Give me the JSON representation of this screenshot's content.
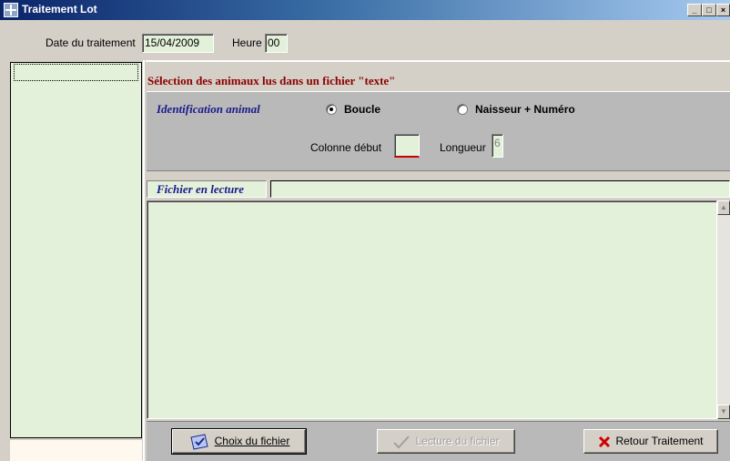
{
  "window": {
    "title": "Traitement Lot"
  },
  "header": {
    "date_label": "Date du traitement",
    "date_value": "15/04/2009",
    "heure_label": "Heure",
    "heure_value": "00"
  },
  "main": {
    "selection_title": "Sélection des animaux lus dans un fichier \"texte\"",
    "ident_label": "Identification animal",
    "radio_options": [
      {
        "label": "Boucle",
        "checked": true
      },
      {
        "label": "Naisseur + Numéro",
        "checked": false
      }
    ],
    "colonne_label": "Colonne début",
    "colonne_value": "",
    "longueur_label": "Longueur",
    "longueur_value": "6",
    "fichier_label": "Fichier en lecture",
    "fichier_value": ""
  },
  "buttons": {
    "choix": {
      "label": "Choix du fichier",
      "icon": "folder-check-icon"
    },
    "lecture": {
      "label": "Lecture du fichier",
      "icon": "checkmark-icon",
      "disabled": true
    },
    "retour": {
      "label": "Retour Traitement",
      "icon": "red-x-icon"
    }
  },
  "colors": {
    "title_gradient_start": "#0a246a",
    "field_bg": "#e3f0da",
    "selection_title": "#8b0000",
    "italic_labels": "#1a1a8c"
  }
}
